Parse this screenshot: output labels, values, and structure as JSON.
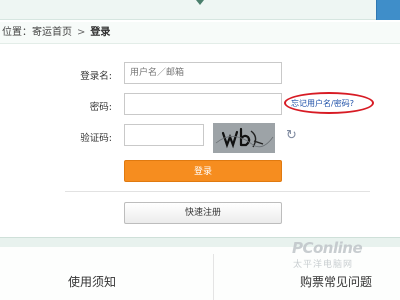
{
  "breadcrumb": {
    "prefix": "位置：寄运首页",
    "separator": ">",
    "current": "登录"
  },
  "form": {
    "username_label": "登录名:",
    "username_placeholder": "用户名／邮箱",
    "password_label": "密码:",
    "password_value": "",
    "forgot_link": "忘记用户名/密码?",
    "captcha_label": "验证码:",
    "captcha_value": "",
    "captcha_text": "wb",
    "login_button": "登录",
    "register_button": "快速注册"
  },
  "footer": {
    "usage_notice": "使用须知",
    "faq": "购票常见问题"
  },
  "watermark": {
    "brand": "PConline",
    "sub": "太平洋电脑网"
  },
  "colors": {
    "accent_orange": "#f68d1f",
    "link_blue": "#1d4fa8",
    "highlight_red": "#d71b24",
    "header_tint": "#eef6f3"
  },
  "icons": {
    "refresh": "refresh-icon",
    "header_arrow": "caret-down-icon"
  }
}
